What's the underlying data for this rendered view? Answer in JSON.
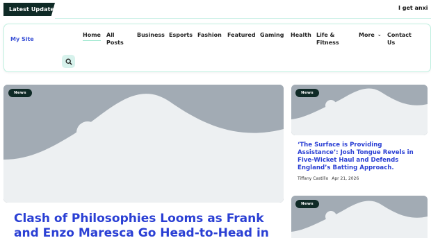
{
  "ticker": {
    "badge": "Latest Update",
    "text": "I get anxi"
  },
  "header": {
    "site_title": "My Site",
    "nav": [
      {
        "label": "Home"
      },
      {
        "label": "All\nPosts"
      },
      {
        "label": "Business"
      },
      {
        "label": "Esports"
      },
      {
        "label": "Fashion"
      },
      {
        "label": "Featured"
      },
      {
        "label": "Gaming"
      },
      {
        "label": "Health"
      },
      {
        "label": "Life &\nFitness"
      },
      {
        "label": "More"
      },
      {
        "label": "Contact\nUs"
      }
    ],
    "search_icon": "search-icon"
  },
  "featured": {
    "badge": "News",
    "title": "Clash of Philosophies Looms as Frank and Enzo Maresca Go Head-to-Head in"
  },
  "side_posts": [
    {
      "badge": "News",
      "title": "‘The Surface is Providing Assistance’: Josh Tongue Revels in Five-Wicket Haul and Defends England’s Batting Approach.",
      "author": "Tiffany Castillo",
      "date": "Apr 21, 2026"
    },
    {
      "badge": "News"
    }
  ],
  "colors": {
    "accent": "#2a3fd4",
    "dark": "#0f2a26",
    "mint": "#bff0e0",
    "placeholder": "#a2abb4"
  }
}
